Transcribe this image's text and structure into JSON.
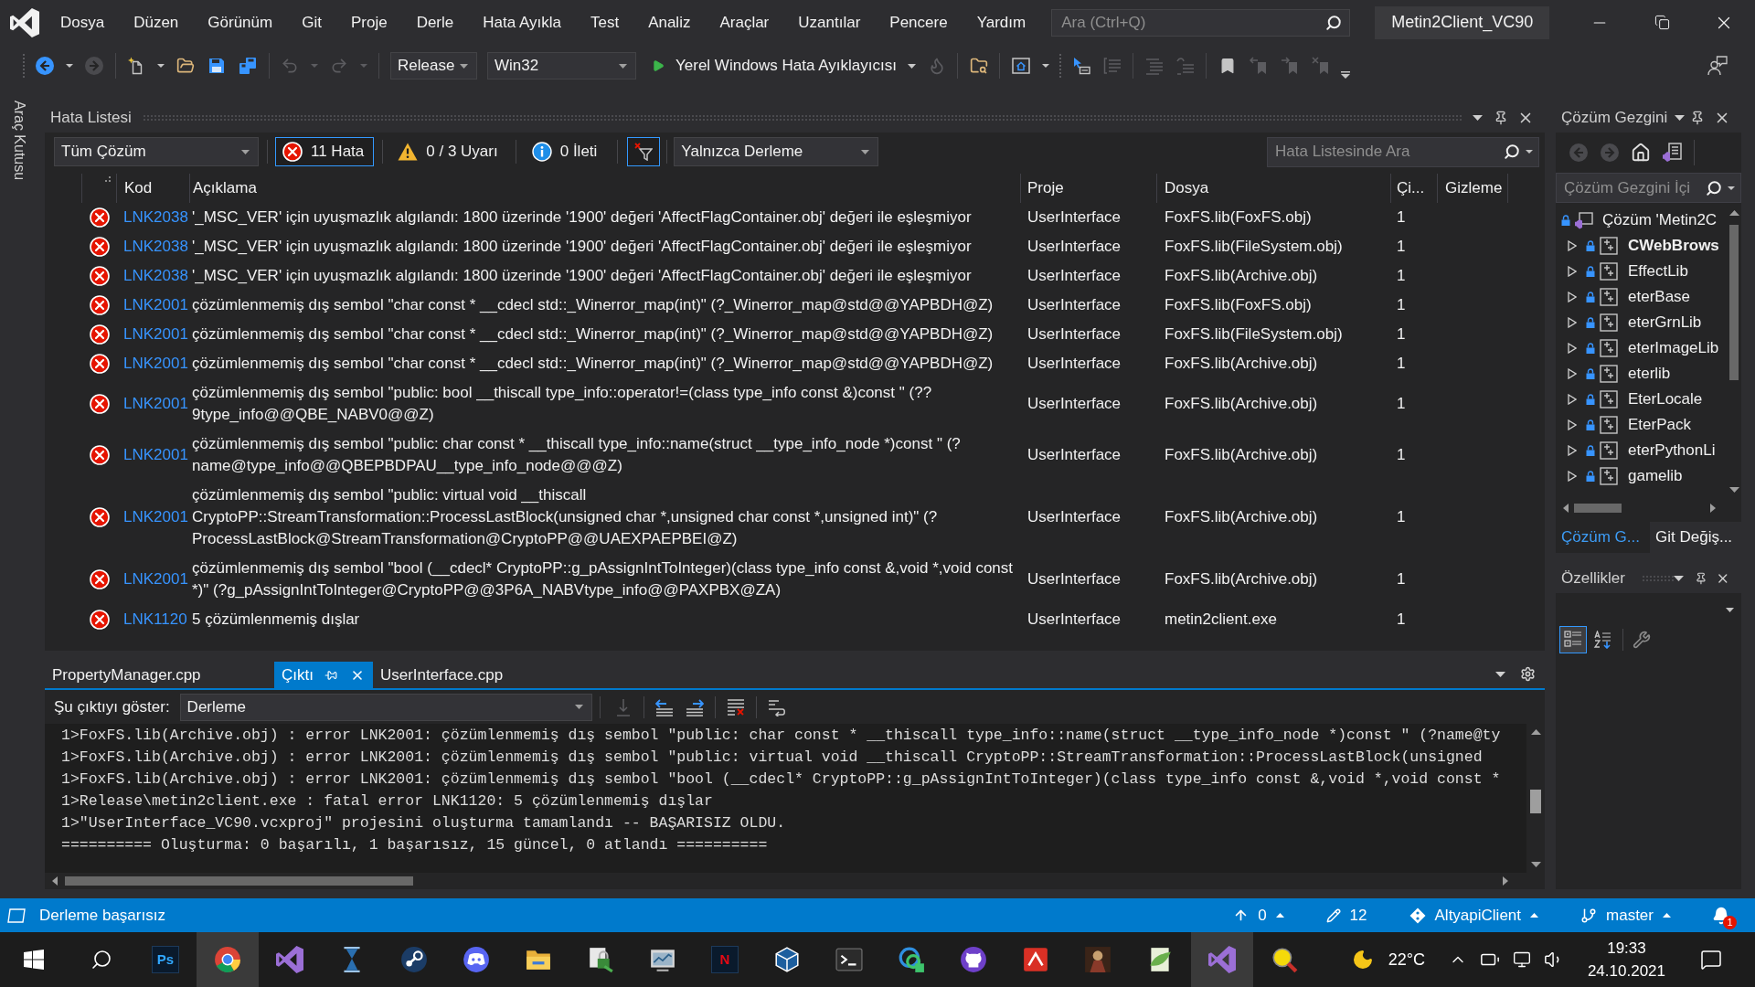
{
  "title_bar": {
    "menu": [
      "Dosya",
      "Düzen",
      "Görünüm",
      "Git",
      "Proje",
      "Derle",
      "Hata Ayıkla",
      "Test",
      "Analiz",
      "Araçlar",
      "Uzantılar",
      "Pencere",
      "Yardım"
    ],
    "search": {
      "placeholder": "Ara (Ctrl+Q)"
    },
    "solution_name": "Metin2Client_VC90"
  },
  "toolbar": {
    "items": [
      {
        "kind": "grip"
      },
      {
        "kind": "back",
        "disabled": false,
        "menu": true
      },
      {
        "kind": "forward",
        "disabled": true
      },
      {
        "kind": "separator"
      },
      {
        "kind": "new",
        "disabled": false,
        "menu": true
      },
      {
        "kind": "open",
        "disabled": false
      },
      {
        "kind": "save",
        "disabled": false
      },
      {
        "kind": "saveall",
        "disabled": false
      },
      {
        "kind": "separator"
      },
      {
        "kind": "undo",
        "disabled": true,
        "menu": true
      },
      {
        "kind": "redo",
        "disabled": true,
        "menu": true
      },
      {
        "kind": "separator"
      },
      {
        "kind": "configuration",
        "value": "Release"
      },
      {
        "kind": "platform",
        "value": "Win32"
      },
      {
        "kind": "start",
        "label": "Yerel Windows Hata Ayıklayıcısı",
        "menu": true
      },
      {
        "kind": "hotreload",
        "disabled": true
      },
      {
        "kind": "separator"
      },
      {
        "kind": "findfolder",
        "disabled": false
      },
      {
        "kind": "separator"
      },
      {
        "kind": "capture",
        "disabled": false,
        "menu": true
      },
      {
        "kind": "grip"
      },
      {
        "kind": "cursor",
        "disabled": false
      },
      {
        "kind": "mark",
        "disabled": true
      },
      {
        "kind": "separator"
      },
      {
        "kind": "comment",
        "disabled": true
      },
      {
        "kind": "uncomment",
        "disabled": true
      },
      {
        "kind": "separator"
      },
      {
        "kind": "bookmark",
        "disabled": false
      },
      {
        "kind": "prevbookmark",
        "disabled": true
      },
      {
        "kind": "nextbookmark",
        "disabled": true
      },
      {
        "kind": "clearbookmark",
        "disabled": true
      },
      {
        "kind": "overflow"
      }
    ]
  },
  "side_strip": {
    "label": "Araç Kutusu"
  },
  "error_list": {
    "title": "Hata Listesi",
    "scope": "Tüm Çözüm",
    "filters": [
      {
        "kind": "error",
        "label": "11 Hata",
        "selected": true
      },
      {
        "kind": "warning",
        "label": "0 / 3 Uyarı",
        "selected": false
      },
      {
        "kind": "info",
        "label": "0 İleti",
        "selected": false
      }
    ],
    "build_filter": {
      "on": true
    },
    "source": "Yalnızca Derleme",
    "search": {
      "placeholder": "Hata Listesinde Ara"
    },
    "columns": [
      "Kod",
      "Açıklama",
      "Proje",
      "Dosya",
      "Çi...",
      "Gizleme"
    ],
    "rows": [
      {
        "kind": "error",
        "code": "LNK2038",
        "description": "'_MSC_VER' için uyuşmazlık algılandı: 1800 üzerinde '1900' değeri 'AffectFlagContainer.obj' değeri ile eşleşmiyor",
        "project": "UserInterface",
        "file": "FoxFS.lib(FoxFS.obj)",
        "line": "1"
      },
      {
        "kind": "error",
        "code": "LNK2038",
        "description": "'_MSC_VER' için uyuşmazlık algılandı: 1800 üzerinde '1900' değeri 'AffectFlagContainer.obj' değeri ile eşleşmiyor",
        "project": "UserInterface",
        "file": "FoxFS.lib(FileSystem.obj)",
        "line": "1"
      },
      {
        "kind": "error",
        "code": "LNK2038",
        "description": "'_MSC_VER' için uyuşmazlık algılandı: 1800 üzerinde '1900' değeri 'AffectFlagContainer.obj' değeri ile eşleşmiyor",
        "project": "UserInterface",
        "file": "FoxFS.lib(Archive.obj)",
        "line": "1"
      },
      {
        "kind": "error",
        "code": "LNK2001",
        "description": "çözümlenmemiş dış sembol \"char const * __cdecl std::_Winerror_map(int)\" (?_Winerror_map@std@@YAPBDH@Z)",
        "project": "UserInterface",
        "file": "FoxFS.lib(FoxFS.obj)",
        "line": "1"
      },
      {
        "kind": "error",
        "code": "LNK2001",
        "description": "çözümlenmemiş dış sembol \"char const * __cdecl std::_Winerror_map(int)\" (?_Winerror_map@std@@YAPBDH@Z)",
        "project": "UserInterface",
        "file": "FoxFS.lib(FileSystem.obj)",
        "line": "1"
      },
      {
        "kind": "error",
        "code": "LNK2001",
        "description": "çözümlenmemiş dış sembol \"char const * __cdecl std::_Winerror_map(int)\" (?_Winerror_map@std@@YAPBDH@Z)",
        "project": "UserInterface",
        "file": "FoxFS.lib(Archive.obj)",
        "line": "1"
      },
      {
        "kind": "error",
        "code": "LNK2001",
        "description": "çözümlenmemiş dış sembol \"public: bool __thiscall type_info::operator!=(class type_info const &)const \" (??9type_info@@QBE_NABV0@@Z)",
        "project": "UserInterface",
        "file": "FoxFS.lib(Archive.obj)",
        "line": "1"
      },
      {
        "kind": "error",
        "code": "LNK2001",
        "description": "çözümlenmemiş dış sembol \"public: char const * __thiscall type_info::name(struct __type_info_node *)const \" (?name@type_info@@QBEPBDPAU__type_info_node@@@Z)",
        "project": "UserInterface",
        "file": "FoxFS.lib(Archive.obj)",
        "line": "1"
      },
      {
        "kind": "error",
        "code": "LNK2001",
        "description": "çözümlenmemiş dış sembol \"public: virtual void __thiscall CryptoPP::StreamTransformation::ProcessLastBlock(unsigned char *,unsigned char const *,unsigned int)\" (?ProcessLastBlock@StreamTransformation@CryptoPP@@UAEXPAEPBEI@Z)",
        "project": "UserInterface",
        "file": "FoxFS.lib(Archive.obj)",
        "line": "1"
      },
      {
        "kind": "error",
        "code": "LNK2001",
        "description": "çözümlenmemiş dış sembol \"bool (__cdecl* CryptoPP::g_pAssignIntToInteger)(class type_info const &,void *,void const *)\" (?g_pAssignIntToInteger@CryptoPP@@3P6A_NABVtype_info@@PAXPBX@ZA)",
        "project": "UserInterface",
        "file": "FoxFS.lib(Archive.obj)",
        "line": "1"
      },
      {
        "kind": "error",
        "code": "LNK1120",
        "description": "5 çözümlenmemiş dışlar",
        "project": "UserInterface",
        "file": "metin2client.exe",
        "line": "1"
      }
    ]
  },
  "document_tabs": [
    {
      "label": "PropertyManager.cpp",
      "selected": false
    },
    {
      "label": "Çıktı",
      "selected": true
    },
    {
      "label": "UserInterface.cpp",
      "selected": false
    }
  ],
  "output": {
    "label": "Şu çıktıyı göster:",
    "source": "Derleme",
    "tools": [
      {
        "kind": "find",
        "disabled": true
      },
      {
        "kind": "separator"
      },
      {
        "kind": "prev",
        "disabled": false
      },
      {
        "kind": "next",
        "disabled": false
      },
      {
        "kind": "separator"
      },
      {
        "kind": "clear",
        "disabled": false
      },
      {
        "kind": "separator"
      },
      {
        "kind": "wrap",
        "disabled": false
      }
    ],
    "lines": [
      "1>FoxFS.lib(Archive.obj) : error LNK2001: çözümlenmemiş dış sembol \"public: char const * __thiscall type_info::name(struct __type_info_node *)const \" (?name@ty",
      "1>FoxFS.lib(Archive.obj) : error LNK2001: çözümlenmemiş dış sembol \"public: virtual void __thiscall CryptoPP::StreamTransformation::ProcessLastBlock(unsigned",
      "1>FoxFS.lib(Archive.obj) : error LNK2001: çözümlenmemiş dış sembol \"bool (__cdecl* CryptoPP::g_pAssignIntToInteger)(class type_info const &,void *,void const *",
      "1>Release\\metin2client.exe : fatal error LNK1120: 5 çözümlenmemiş dışlar",
      "1>\"UserInterface_VC90.vcxproj\" projesini oluşturma tamamlandı -- BAŞARISIZ OLDU.",
      "========== Oluşturma: 0 başarılı, 1 başarısız, 15 güncel, 0 atlandı =========="
    ]
  },
  "solution_explorer": {
    "title": "Çözüm Gezgini",
    "toolbar": [
      {
        "kind": "back",
        "disabled": true
      },
      {
        "kind": "forward",
        "disabled": true
      },
      {
        "kind": "home",
        "disabled": false
      },
      {
        "kind": "views",
        "disabled": false
      }
    ],
    "search": {
      "placeholder": "Çözüm Gezgini İçi"
    },
    "tree": [
      {
        "label": "Çözüm 'Metin2C",
        "children": [
          {
            "label": "CWebBrows",
            "expanded": false,
            "startup": true
          },
          {
            "label": "EffectLib",
            "expanded": false,
            "startup": false
          },
          {
            "label": "eterBase",
            "expanded": false,
            "startup": false
          },
          {
            "label": "eterGrnLib",
            "expanded": false,
            "startup": false
          },
          {
            "label": "eterImageLib",
            "expanded": false,
            "startup": false
          },
          {
            "label": "eterlib",
            "expanded": false,
            "startup": false
          },
          {
            "label": "EterLocale",
            "expanded": false,
            "startup": false
          },
          {
            "label": "EterPack",
            "expanded": false,
            "startup": false
          },
          {
            "label": "eterPythonLi",
            "expanded": false,
            "startup": false
          },
          {
            "label": "gamelib",
            "expanded": false,
            "startup": false
          }
        ]
      }
    ],
    "tabs": [
      {
        "label": "Çözüm G...",
        "selected": true
      },
      {
        "label": "Git Değiş...",
        "selected": false
      }
    ]
  },
  "properties": {
    "title": "Özellikler",
    "views": [
      {
        "kind": "categorized",
        "selected": true
      },
      {
        "kind": "alphabetical",
        "selected": false
      }
    ]
  },
  "status_bar": {
    "message": "Derleme başarısız",
    "items": [
      {
        "kind": "push",
        "label": "0",
        "menu": true
      },
      {
        "kind": "changes",
        "label": "12"
      },
      {
        "kind": "repository",
        "label": "AltyapiClient",
        "menu": true
      },
      {
        "kind": "branch",
        "label": "master",
        "menu": true
      },
      {
        "kind": "notifications",
        "badge": "1"
      }
    ]
  },
  "taskbar": {
    "apps": [
      {
        "kind": "letter",
        "label": "Ps",
        "color": "#31a8ff",
        "highlighted": false
      },
      {
        "kind": "browser",
        "highlighted": true
      },
      {
        "kind": "ribbon",
        "highlighted": false
      },
      {
        "kind": "hourglass",
        "highlighted": false
      },
      {
        "kind": "piston",
        "highlighted": false
      },
      {
        "kind": "chat",
        "highlighted": false
      },
      {
        "kind": "folder",
        "highlighted": false
      },
      {
        "kind": "lockdoc",
        "highlighted": false
      },
      {
        "kind": "chartwin",
        "highlighted": false
      },
      {
        "kind": "letter",
        "label": "N",
        "color": "#e50914",
        "highlighted": false
      },
      {
        "kind": "cube",
        "highlighted": false
      },
      {
        "kind": "terminal",
        "highlighted": false
      },
      {
        "kind": "rings",
        "highlighted": false
      },
      {
        "kind": "catcircle",
        "highlighted": false
      },
      {
        "kind": "redtile",
        "highlighted": false
      },
      {
        "kind": "gameart",
        "highlighted": false
      },
      {
        "kind": "leafdoc",
        "highlighted": false
      },
      {
        "kind": "ribbon",
        "highlighted": true
      },
      {
        "kind": "magnifier",
        "highlighted": false
      }
    ],
    "tray": {
      "weather": "22°C",
      "time": "19:33",
      "date": "24.10.2021"
    }
  }
}
